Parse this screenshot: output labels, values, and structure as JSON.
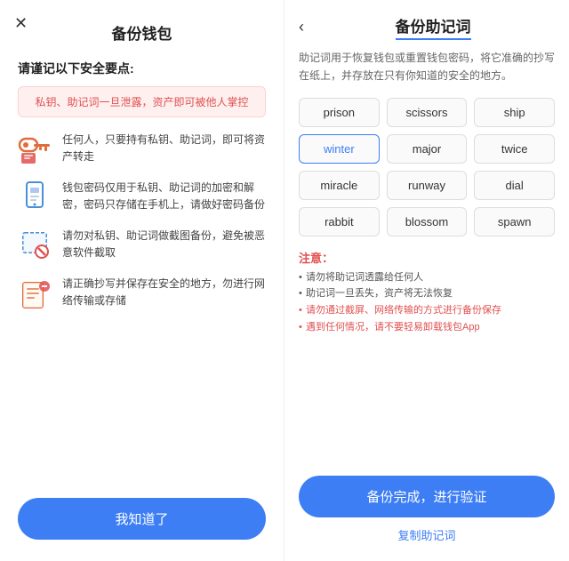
{
  "left": {
    "close_label": "✕",
    "title": "备份钱包",
    "subtitle": "请谨记以下安全要点:",
    "warning": "私钥、助记词一旦泄露，资产即可被他人掌控",
    "tips": [
      {
        "icon": "🔑",
        "text": "任何人，只要持有私钥、助记词，即可将资产转走"
      },
      {
        "icon": "📱",
        "text": "钱包密码仅用于私钥、助记词的加密和解密，密码只存储在手机上，请做好密码备份"
      },
      {
        "icon": "📷",
        "text": "请勿对私钥、助记词做截图备份，避免被恶意软件截取"
      },
      {
        "icon": "📄",
        "text": "请正确抄写并保存在安全的地方，勿进行网络传输或存储"
      }
    ],
    "bottom_btn": "我知道了"
  },
  "right": {
    "back_label": "‹",
    "title": "备份助记词",
    "desc": "助记词用于恢复钱包或重置钱包密码，将它准确的抄写在纸上，并存放在只有你知道的安全的地方。",
    "words": [
      {
        "text": "prison",
        "highlighted": false
      },
      {
        "text": "scissors",
        "highlighted": false
      },
      {
        "text": "ship",
        "highlighted": false
      },
      {
        "text": "winter",
        "highlighted": true
      },
      {
        "text": "major",
        "highlighted": false
      },
      {
        "text": "twice",
        "highlighted": false
      },
      {
        "text": "miracle",
        "highlighted": false
      },
      {
        "text": "runway",
        "highlighted": false
      },
      {
        "text": "dial",
        "highlighted": false
      },
      {
        "text": "rabbit",
        "highlighted": false
      },
      {
        "text": "blossom",
        "highlighted": false
      },
      {
        "text": "spawn",
        "highlighted": false
      }
    ],
    "notice_title": "注意：",
    "notices": [
      {
        "text": "请勿将助记词透露给任何人",
        "red": false
      },
      {
        "text": "助记词一旦丢失，资产将无法恢复",
        "red": false
      },
      {
        "text": "请勿通过截屏、网络传输的方式进行备份保存",
        "red": true
      },
      {
        "text": "遇到任何情况，请不要轻易卸载钱包App",
        "red": true
      }
    ],
    "verify_btn": "备份完成，进行验证",
    "copy_link": "复制助记词"
  }
}
